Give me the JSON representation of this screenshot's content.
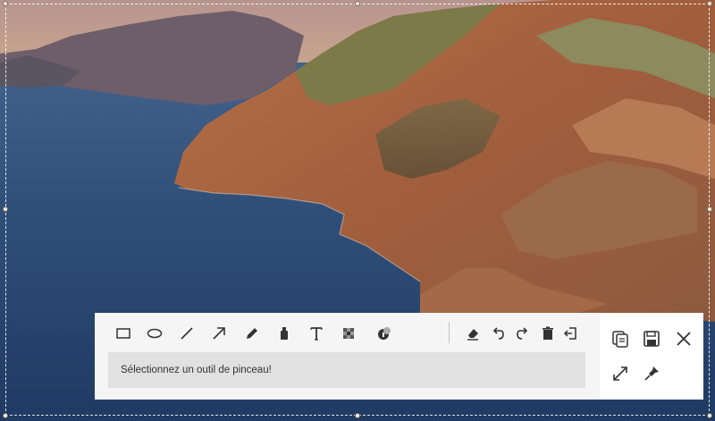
{
  "toolbar": {
    "tools": [
      {
        "name": "rectangle-icon"
      },
      {
        "name": "ellipse-icon"
      },
      {
        "name": "line-icon"
      },
      {
        "name": "arrow-icon"
      },
      {
        "name": "pencil-icon"
      },
      {
        "name": "marker-icon"
      },
      {
        "name": "text-icon"
      },
      {
        "name": "mosaic-icon"
      },
      {
        "name": "step-number-icon"
      },
      {
        "name": "eraser-icon"
      },
      {
        "name": "undo-icon"
      },
      {
        "name": "redo-icon"
      },
      {
        "name": "trash-icon"
      },
      {
        "name": "exit-icon"
      }
    ],
    "hint": "Sélectionnez un outil de pinceau!"
  },
  "side_actions": [
    {
      "name": "copy-icon"
    },
    {
      "name": "save-icon"
    },
    {
      "name": "close-icon"
    },
    {
      "name": "fullscreen-icon"
    },
    {
      "name": "pin-icon"
    }
  ],
  "colors": {
    "selection_border": "#ffffff",
    "toolbar_bg": "#f5f5f5",
    "hint_bg": "#e1e1e1",
    "icon": "#333333"
  }
}
